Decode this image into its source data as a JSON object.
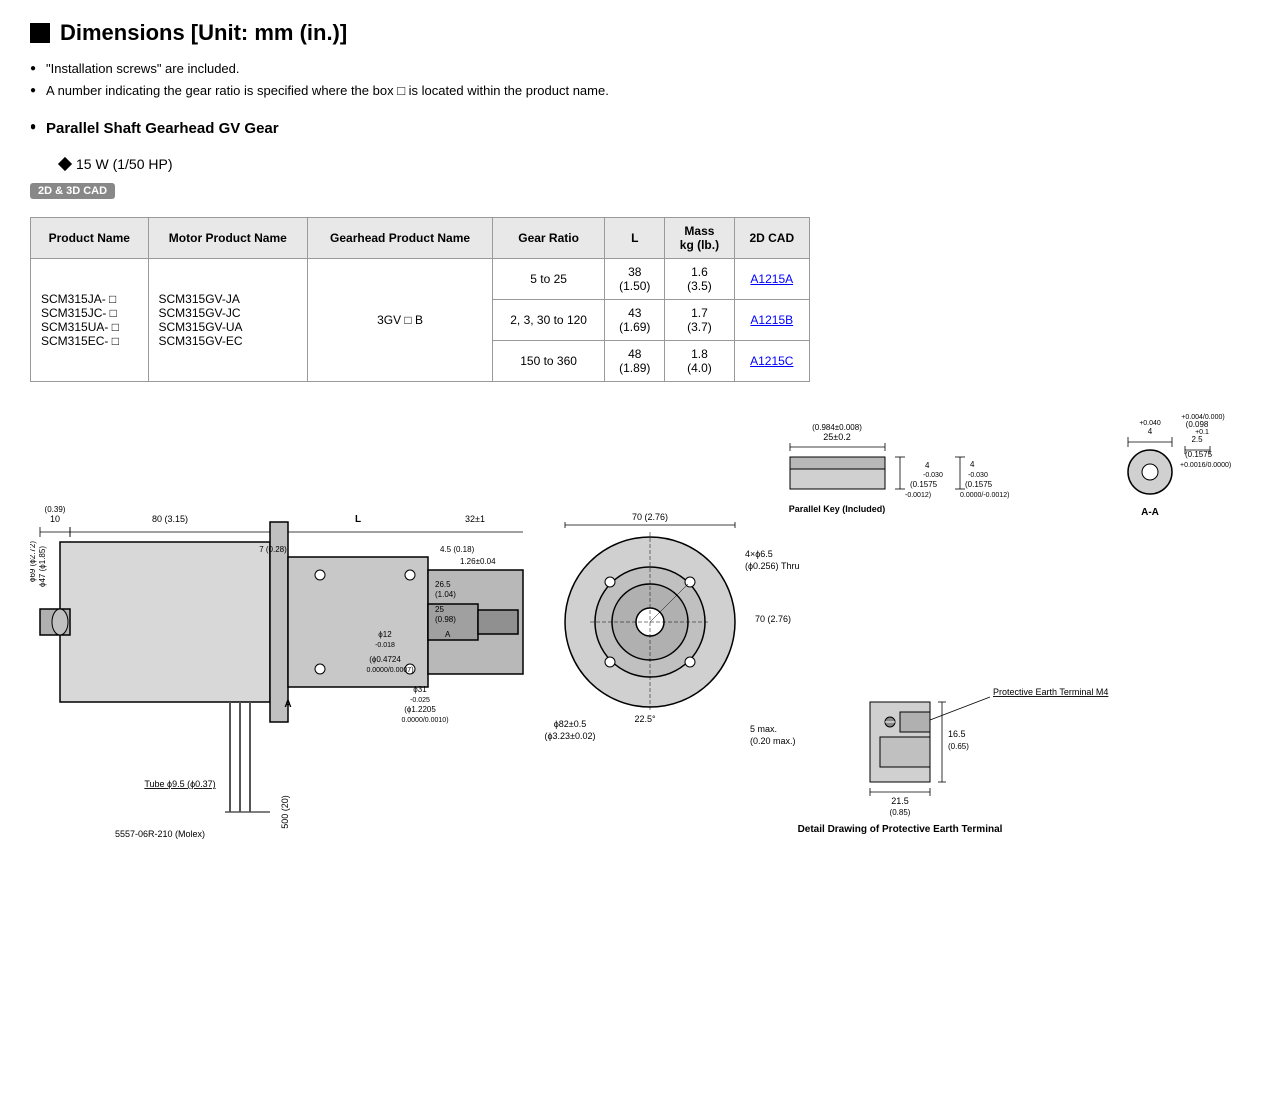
{
  "page": {
    "title": "Dimensions [Unit: mm (in.)]",
    "bullets": [
      "\"Installation screws\" are included.",
      "A number indicating the gear ratio is specified where the box □ is located within the product name."
    ],
    "section_title": "Parallel Shaft Gearhead GV Gear",
    "sub_title": "15 W (1/50 HP)",
    "cad_badge": "2D & 3D CAD"
  },
  "table": {
    "headers": [
      "Product Name",
      "Motor Product Name",
      "Gearhead Product Name",
      "Gear Ratio",
      "L",
      "Mass\nkg (lb.)",
      "2D CAD"
    ],
    "rows": [
      {
        "product_names": [
          "SCM315JA- □",
          "SCM315JC- □",
          "SCM315UA- □",
          "SCM315EC- □"
        ],
        "motor_names": [
          "SCM315GV-JA",
          "SCM315GV-JC",
          "SCM315GV-UA",
          "SCM315GV-EC"
        ],
        "gearhead": "3GV □ B",
        "sub_rows": [
          {
            "gear_ratio": "5 to 25",
            "L": "38\n(1.50)",
            "mass": "1.6\n(3.5)",
            "cad": "A1215A"
          },
          {
            "gear_ratio": "2, 3, 30 to 120",
            "L": "43\n(1.69)",
            "mass": "1.7\n(3.7)",
            "cad": "A1215B"
          },
          {
            "gear_ratio": "150 to 360",
            "L": "48\n(1.89)",
            "mass": "1.8\n(4.0)",
            "cad": "A1215C"
          }
        ]
      }
    ]
  },
  "drawing": {
    "dimensions": {
      "main": [
        "10 (0.39)",
        "80 (3.15)",
        "L",
        "32±1",
        "7 (0.28)",
        "4.5 (0.18)",
        "1.26±0.04",
        "26.5 (1.04)",
        "25 (0.98)",
        "A",
        "ϕ12-0.018",
        "ϕ0.4724 (0.47±0.02)",
        "ϕ31-0.025",
        "ϕ1.2205 (0.0010)",
        "ϕ69 (ϕ2.72)",
        "ϕ47 (ϕ1.85)",
        "70 (2.76)",
        "4×ϕ6.5 (ϕ0.256) Thru",
        "70 (2.76)",
        "ϕ82±0.5 (ϕ3.23±0.02)",
        "5 max. (0.20 max.)",
        "22.5°",
        "Tube ϕ9.5 (ϕ0.37)",
        "500 (20)",
        "5557-06R-210 (Molex)"
      ],
      "key": {
        "title": "Parallel Key (Included)",
        "dims": [
          "25±0.2 (0.984±0.008)",
          "4-0.030 (0.1575-0.0012)",
          "4-0.030 (0.1575-0.0000/0.0012)"
        ]
      },
      "section_aa": {
        "title": "A-A",
        "dims": [
          "4+0.040 (0.1575+0.0016/0.0000)",
          "2.5+0.1 (0.098+0.004/0.000)"
        ]
      },
      "earth_terminal": {
        "title": "Detail Drawing of Protective Earth Terminal",
        "label": "Protective Earth Terminal M4",
        "dims": [
          "21.5 (0.85)",
          "16.5 (0.65)"
        ]
      }
    }
  }
}
